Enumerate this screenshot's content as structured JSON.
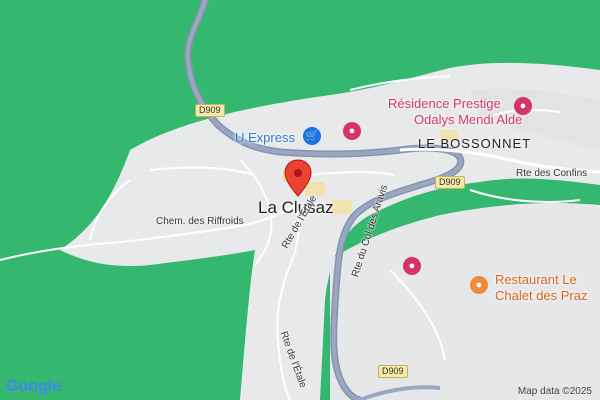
{
  "map": {
    "town": "La Clusaz",
    "area_label": "LE BOSSONNET",
    "roads": {
      "d909_a": "D909",
      "d909_b": "D909",
      "d909_c": "D909",
      "rte_confins": "Rte des Confins",
      "chem_riffroids": "Chem. des Riffroids",
      "rte_etale_upper": "Rte de l'Étale",
      "rte_etale_lower": "Rte de l'Étale",
      "rte_col_aravis": "Rte du Col des Aravis"
    },
    "pois": {
      "residence": "Résidence Prestige Odalys Mendi Alde",
      "residence_line1": "Résidence Prestige",
      "residence_line2": "Odalys Mendi Alde",
      "uexpress": "U Express",
      "restaurant_line1": "Restaurant Le",
      "restaurant_line2": "Chalet des Praz"
    },
    "colors": {
      "forest": "#34b870",
      "urban": "#e9eaec",
      "road": "#7b8ca6",
      "hotel": "#d6336c",
      "restaurant": "#f08a3c",
      "shop": "#1a73e8",
      "pin": "#ea4335"
    }
  },
  "footer": {
    "logo": "Google",
    "attribution": "Map data ©2025"
  }
}
